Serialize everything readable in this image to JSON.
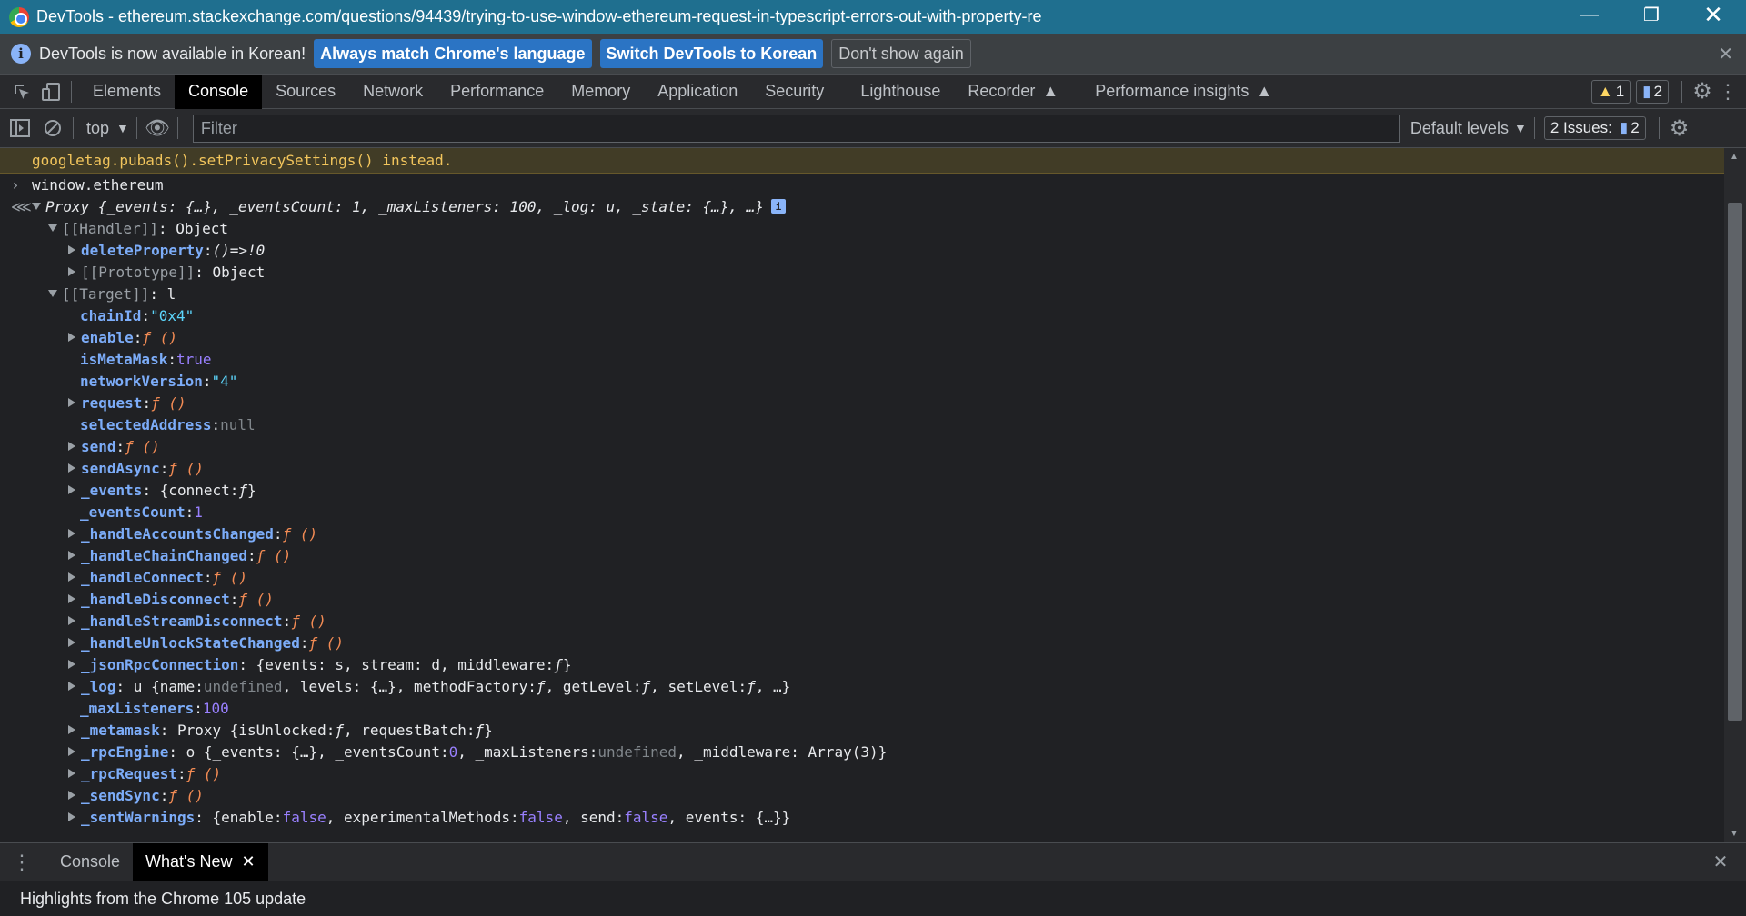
{
  "window": {
    "title": "DevTools - ethereum.stackexchange.com/questions/94439/trying-to-use-window-ethereum-request-in-typescript-errors-out-with-property-re"
  },
  "infobar": {
    "message": "DevTools is now available in Korean!",
    "btn_match": "Always match Chrome's language",
    "btn_switch": "Switch DevTools to Korean",
    "btn_dismiss": "Don't show again"
  },
  "tabs": [
    "Elements",
    "Console",
    "Sources",
    "Network",
    "Performance",
    "Memory",
    "Application",
    "Security",
    "Lighthouse",
    "Recorder",
    "Performance insights"
  ],
  "counters": {
    "warnings": "1",
    "messages": "2"
  },
  "consolebar": {
    "context": "top",
    "filter_placeholder": "Filter",
    "levels": "Default levels",
    "issues_label": "2 Issues:",
    "issues_count": "2"
  },
  "console": {
    "warning_text": "googletag.pubads().setPrivacySettings() instead.",
    "input_expr": "window.ethereum",
    "result_head": "{_events: {…}, _eventsCount: 1, _maxListeners: 100, _log: u, _state: {…}, …}",
    "result_type": "Proxy"
  },
  "drawer": {
    "tabs": [
      "Console",
      "What's New"
    ],
    "content": "Highlights from the Chrome 105 update"
  }
}
